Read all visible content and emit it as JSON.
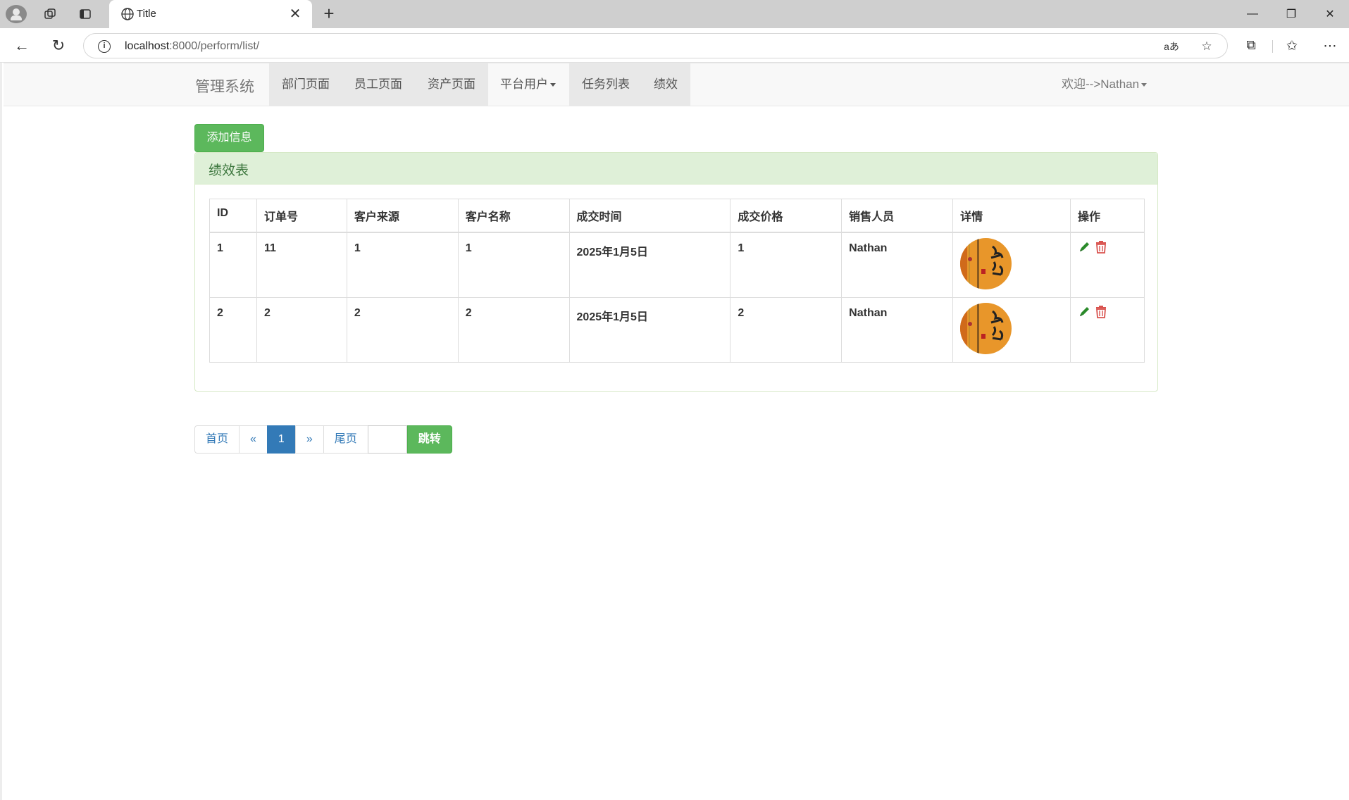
{
  "browser": {
    "tab_title": "Title",
    "url_host": "localhost",
    "url_rest": ":8000/perform/list/"
  },
  "navbar": {
    "brand": "管理系统",
    "items": [
      {
        "label": "部门页面"
      },
      {
        "label": "员工页面"
      },
      {
        "label": "资产页面"
      },
      {
        "label": "平台用户"
      },
      {
        "label": "任务列表"
      },
      {
        "label": "绩效"
      }
    ],
    "welcome": "欢迎-->Nathan"
  },
  "actions": {
    "add_label": "添加信息"
  },
  "panel": {
    "title": "绩效表",
    "columns": [
      "ID",
      "订单号",
      "客户来源",
      "客户名称",
      "成交时间",
      "成交价格",
      "销售人员",
      "详情",
      "操作"
    ],
    "rows": [
      {
        "id": "1",
        "order_no": "11",
        "source": "1",
        "customer": "1",
        "date": "2025年1月5日",
        "price": "1",
        "sales": "Nathan"
      },
      {
        "id": "2",
        "order_no": "2",
        "source": "2",
        "customer": "2",
        "date": "2025年1月5日",
        "price": "2",
        "sales": "Nathan"
      }
    ]
  },
  "pagination": {
    "first": "首页",
    "prev": "«",
    "current": "1",
    "next": "»",
    "last": "尾页",
    "go": "跳转"
  },
  "colors": {
    "success": "#5cb85c",
    "primary": "#337ab7",
    "panel_heading_bg": "#dff0d8",
    "edit_icon": "#2a8a2a",
    "delete_icon": "#d9534f"
  }
}
